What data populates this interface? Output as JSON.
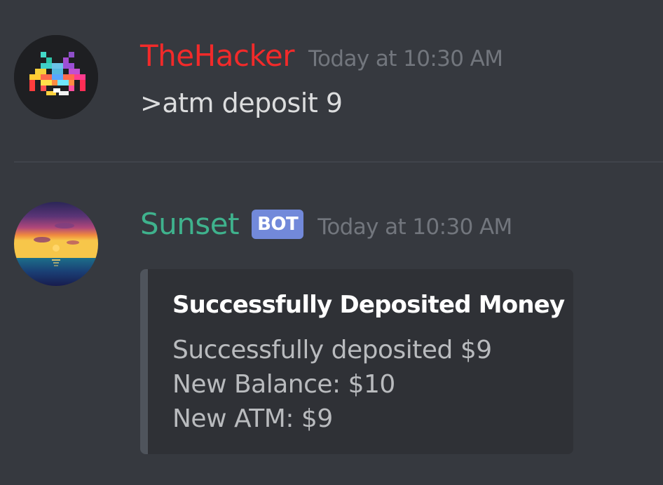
{
  "messages": [
    {
      "author": "TheHacker",
      "author_color": "#f22a2a",
      "timestamp": "Today at 10:30 AM",
      "content": ">atm deposit 9",
      "avatar": "space-invader-avatar"
    },
    {
      "author": "Sunset",
      "author_color": "#3fb28d",
      "bot_tag": "BOT",
      "bot_tag_color": "#7289da",
      "timestamp": "Today at 10:30 AM",
      "avatar": "sunset-avatar",
      "embed": {
        "title": "Successfully Deposited Money",
        "lines": [
          "Successfully deposited $9",
          "New Balance: $10",
          "New ATM: $9"
        ]
      }
    }
  ],
  "colors": {
    "background": "#36393f",
    "embed_background": "#2f3136",
    "embed_border": "#4f545c",
    "timestamp": "#72767d",
    "text": "#dcddde"
  }
}
